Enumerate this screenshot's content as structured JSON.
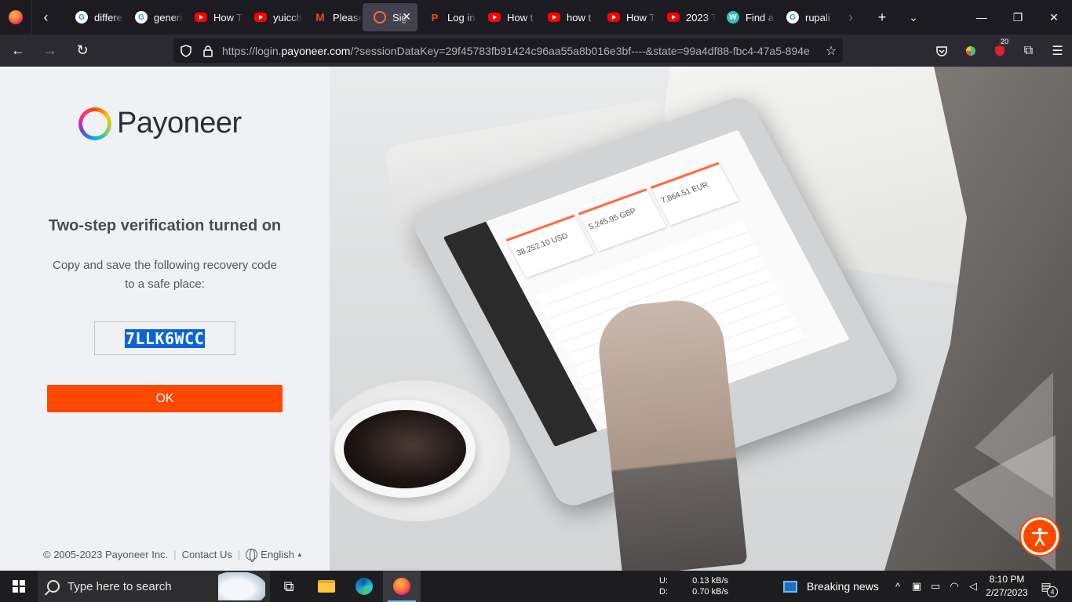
{
  "browser": {
    "tabs": [
      {
        "icon": "google-icon",
        "label": "differe"
      },
      {
        "icon": "google-icon",
        "label": "generi"
      },
      {
        "icon": "youtube-icon",
        "label": "How T"
      },
      {
        "icon": "youtube-icon",
        "label": "yuicch"
      },
      {
        "icon": "gmail-icon",
        "label": "Please"
      },
      {
        "icon": "payoneer-icon",
        "label": "Sign"
      },
      {
        "icon": "paypal-icon",
        "label": "Log in"
      },
      {
        "icon": "youtube-icon",
        "label": "How t"
      },
      {
        "icon": "youtube-icon",
        "label": "how t"
      },
      {
        "icon": "youtube-icon",
        "label": "How T"
      },
      {
        "icon": "youtube-icon",
        "label": "2023 T"
      },
      {
        "icon": "wix-icon",
        "label": "Find a"
      },
      {
        "icon": "google-icon",
        "label": "rupali"
      }
    ],
    "url_prefix": "https://login.",
    "url_host": "payoneer.com",
    "url_rest": "/?sessionDataKey=29f45783fb91424c96aa55a8b016e3bf----&state=99a4df88-fbc4-47a5-894e",
    "extension_badge": "20"
  },
  "page": {
    "brand": "Payoneer",
    "heading": "Two-step verification turned on",
    "instruction_line1": "Copy and save the following recovery code",
    "instruction_line2": "to a safe place:",
    "recovery_code": "7LLK6WCC",
    "ok_label": "OK",
    "footer": {
      "copyright": "© 2005-2023 Payoneer Inc.",
      "contact": "Contact Us",
      "language": "English"
    },
    "tablet_amounts": [
      "38,252.10 USD",
      "5,245.95 GBP",
      "7,864.51 EUR"
    ]
  },
  "taskbar": {
    "search_placeholder": "Type here to search",
    "net_up_label": "U:",
    "net_down_label": "D:",
    "net_up": "0.13 kB/s",
    "net_down": "0.70 kB/s",
    "news": "Breaking news",
    "time": "8:10 PM",
    "date": "2/27/2023",
    "notification_count": "4"
  },
  "colors": {
    "accent": "#ff4800",
    "selection": "#0a64d8"
  }
}
